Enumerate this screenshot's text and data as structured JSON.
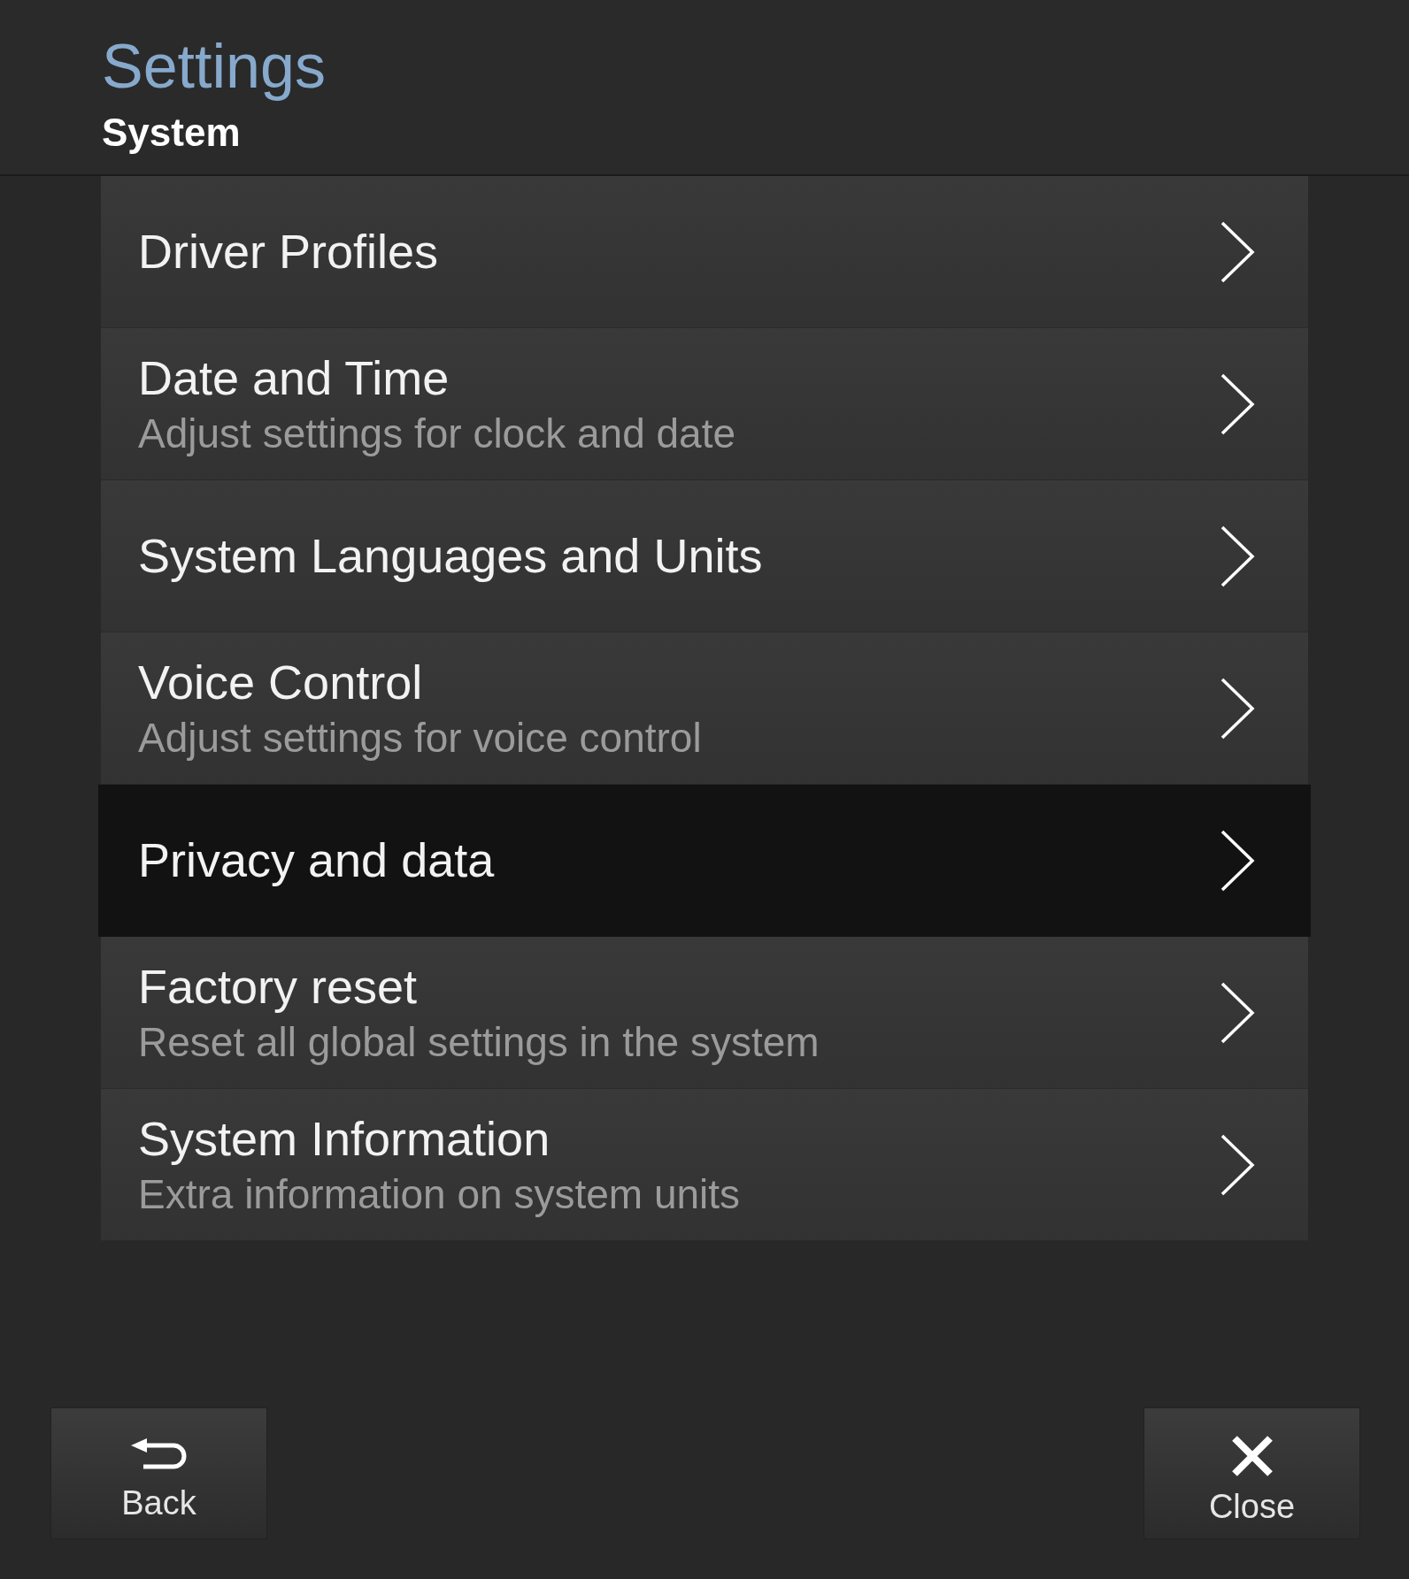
{
  "header": {
    "title": "Settings",
    "subtitle": "System"
  },
  "menu": [
    {
      "title": "Driver Profiles",
      "selected": false
    },
    {
      "title": "Date and Time",
      "description": "Adjust settings for clock and date",
      "selected": false
    },
    {
      "title": "System Languages and Units",
      "selected": false
    },
    {
      "title": "Voice Control",
      "description": "Adjust settings for voice control",
      "selected": false
    },
    {
      "title": "Privacy and data",
      "selected": true
    },
    {
      "title": "Factory reset",
      "description": "Reset all global settings in the system",
      "selected": false
    },
    {
      "title": "System Information",
      "description": "Extra information on system units",
      "selected": false
    }
  ],
  "buttons": [
    {
      "kind": "back",
      "label": "Back"
    },
    {
      "kind": "close",
      "label": "Close"
    }
  ]
}
